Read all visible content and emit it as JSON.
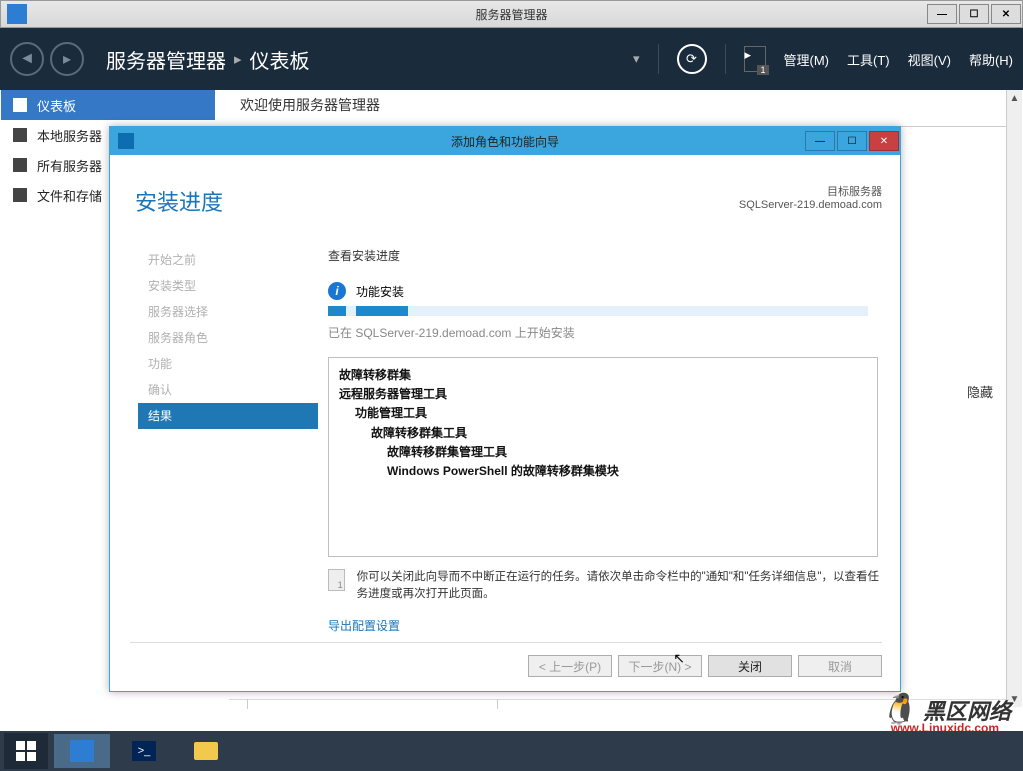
{
  "main_window": {
    "title": "服务器管理器",
    "breadcrumb_app": "服务器管理器",
    "breadcrumb_page": "仪表板",
    "menu": {
      "manage": "管理(M)",
      "tools": "工具(T)",
      "view": "视图(V)",
      "help": "帮助(H)"
    },
    "flag_badge": "1"
  },
  "sidebar": {
    "items": [
      {
        "label": "仪表板",
        "active": true
      },
      {
        "label": "本地服务器",
        "active": false
      },
      {
        "label": "所有服务器",
        "active": false
      },
      {
        "label": "文件和存储",
        "active": false
      }
    ]
  },
  "content": {
    "welcome": "欢迎使用服务器管理器",
    "hide": "隐藏"
  },
  "wizard": {
    "title": "添加角色和功能向导",
    "heading": "安装进度",
    "target_label": "目标服务器",
    "target_server": "SQLServer-219.demoad.com",
    "nav": [
      "开始之前",
      "安装类型",
      "服务器选择",
      "服务器角色",
      "功能",
      "确认",
      "结果"
    ],
    "nav_current_index": 6,
    "section_label": "查看安装进度",
    "install_label": "功能安装",
    "status_line": "已在 SQLServer-219.demoad.com 上开始安装",
    "results": {
      "l1": "故障转移群集",
      "l2": "远程服务器管理工具",
      "l3": "功能管理工具",
      "l4": "故障转移群集工具",
      "l5": "故障转移群集管理工具",
      "l6": "Windows PowerShell 的故障转移群集模块"
    },
    "note_badge": "1",
    "note": "你可以关闭此向导而不中断正在运行的任务。请依次单击命令栏中的\"通知\"和\"任务详细信息\"，以查看任务进度或再次打开此页面。",
    "export_link": "导出配置设置",
    "buttons": {
      "prev": "< 上一步(P)",
      "next": "下一步(N) >",
      "close": "关闭",
      "cancel": "取消"
    }
  },
  "watermark": {
    "brand": "黑区网络",
    "url": "www.Linuxidc.com"
  }
}
